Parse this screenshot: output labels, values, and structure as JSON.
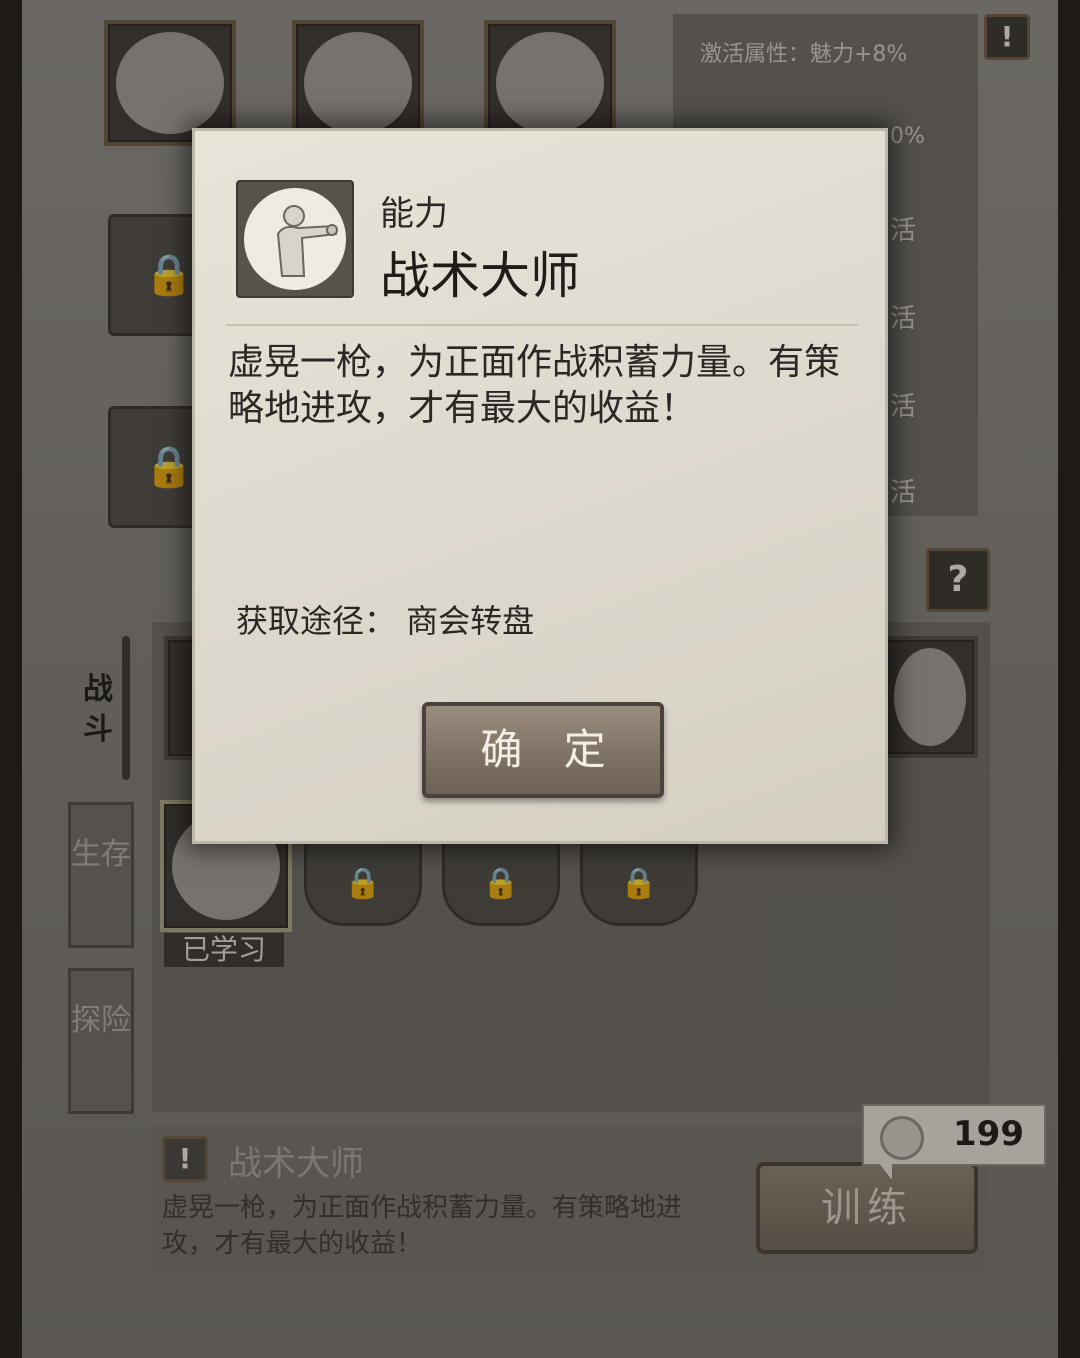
{
  "top_panel": {
    "attribute_text": "激活属性：魅力+8%",
    "partial_percent": "0%",
    "activate_glyph": "活",
    "info_badge": "!"
  },
  "tabs": {
    "combat": "战斗",
    "survival": "生存",
    "explore": "探险",
    "help_badge": "?"
  },
  "skills": {
    "learned_label": "已学习"
  },
  "info_panel": {
    "badge": "!",
    "title": "战术大师",
    "description": "虚晃一枪，为正面作战积蓄力量。有策略地进攻，才有最大的收益！"
  },
  "train_button": "训练",
  "currency": {
    "amount": "199",
    "icon": "coin-icon"
  },
  "modal": {
    "category": "能力",
    "title": "战术大师",
    "description": "虚晃一枪，为正面作战积蓄力量。有策略地进攻，才有最大的收益！",
    "source": "获取途径：  商会转盘",
    "confirm": "确 定",
    "icon": "boxer-icon"
  }
}
